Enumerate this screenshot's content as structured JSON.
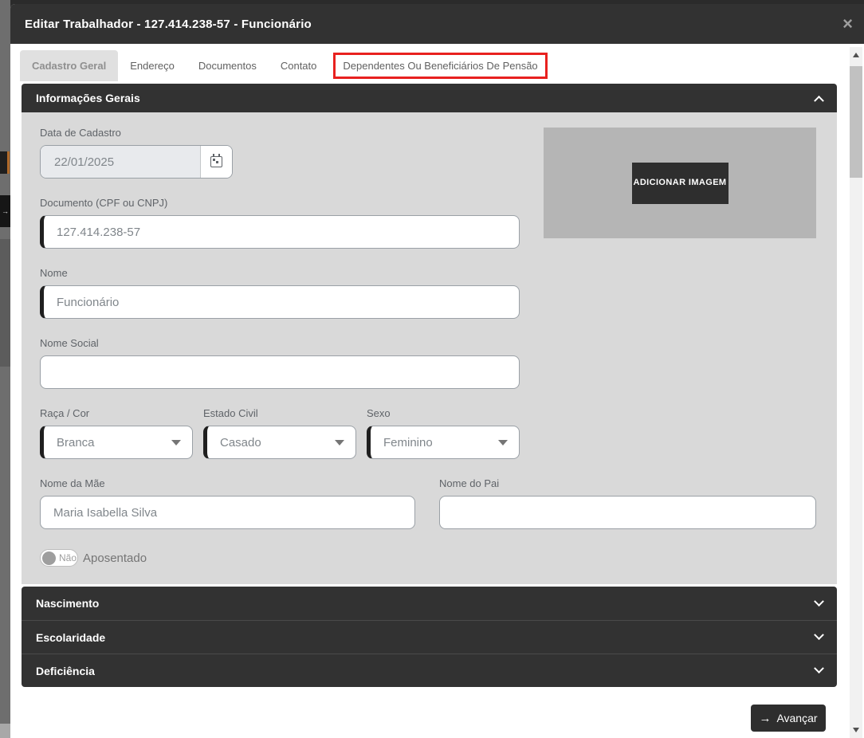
{
  "window": {
    "title": "Editar Trabalhador - 127.414.238-57 - Funcionário",
    "close_icon": "×"
  },
  "tabs": [
    {
      "label": "Cadastro Geral",
      "active": true
    },
    {
      "label": "Endereço",
      "active": false
    },
    {
      "label": "Documentos",
      "active": false
    },
    {
      "label": "Contato",
      "active": false
    },
    {
      "label": "Dependentes Ou Beneficiários De Pensão",
      "active": false,
      "highlighted": true
    }
  ],
  "annotation": {
    "type": "red-highlight-box",
    "target": "Dependentes Ou Beneficiários De Pensão",
    "color": "#e8211f"
  },
  "sections": [
    {
      "title": "Informações Gerais",
      "state": "expanded"
    },
    {
      "title": "Nascimento",
      "state": "collapsed"
    },
    {
      "title": "Escolaridade",
      "state": "collapsed"
    },
    {
      "title": "Deficiência",
      "state": "collapsed"
    }
  ],
  "form": {
    "data_cadastro": {
      "label": "Data de Cadastro",
      "value": "22/01/2025"
    },
    "documento": {
      "label": "Documento (CPF ou CNPJ)",
      "value": "127.414.238-57"
    },
    "nome": {
      "label": "Nome",
      "value": "Funcionário"
    },
    "nome_social": {
      "label": "Nome Social",
      "value": ""
    },
    "raca_cor": {
      "label": "Raça / Cor",
      "value": "Branca"
    },
    "estado_civil": {
      "label": "Estado Civil",
      "value": "Casado"
    },
    "sexo": {
      "label": "Sexo",
      "value": "Feminino"
    },
    "nome_mae": {
      "label": "Nome da Mãe",
      "value": "Maria Isabella Silva"
    },
    "nome_pai": {
      "label": "Nome do Pai",
      "value": ""
    },
    "aposentado": {
      "label": "Aposentado",
      "toggle_value": "Não",
      "state": "off"
    }
  },
  "image_upload": {
    "button_label": "ADICIONAR IMAGEM"
  },
  "footer": {
    "advance_label": "Avançar",
    "advance_icon": "→"
  },
  "colors": {
    "header_bg": "#323232",
    "panel_bg": "#d9d9d9",
    "annotation_red": "#e8211f",
    "dark_button": "#2e2e2e",
    "image_placeholder": "#b5b5b5",
    "active_tab_bg": "#e0e0e0"
  }
}
